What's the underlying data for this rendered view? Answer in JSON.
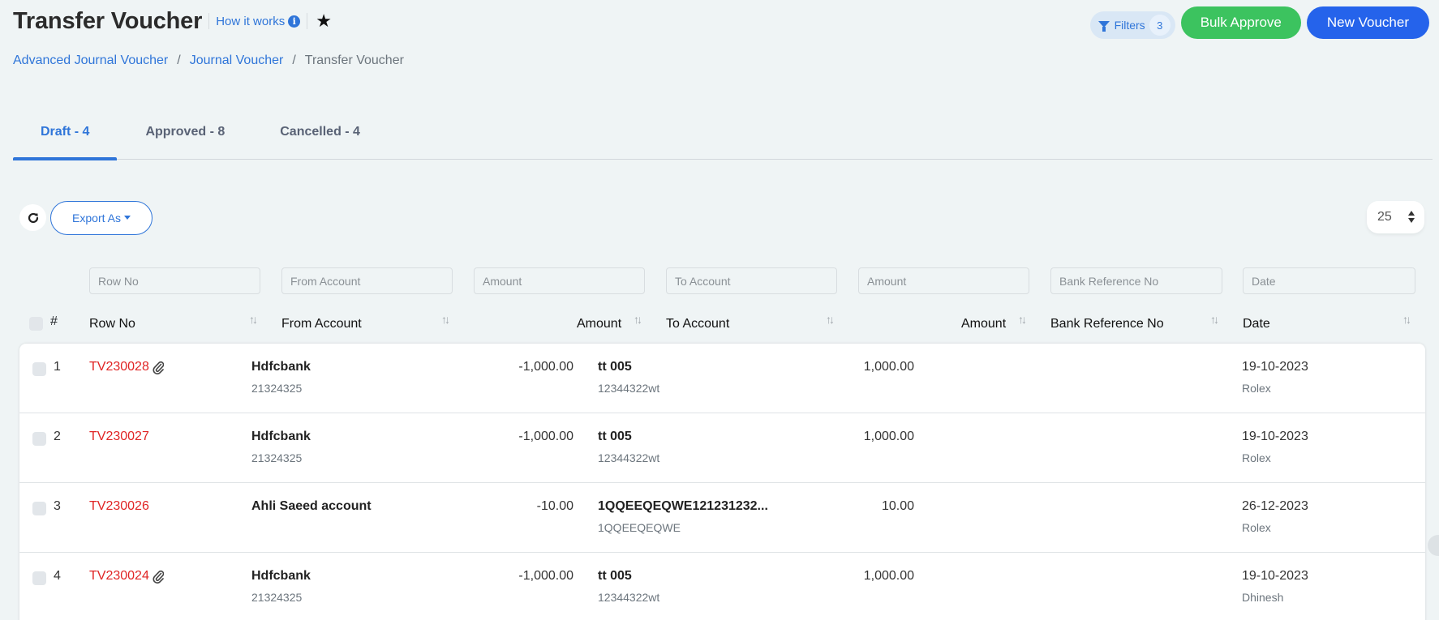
{
  "header": {
    "title": "Transfer Voucher",
    "how_it_works": "How it works",
    "info_icon": "info-circle-icon",
    "star_icon": "star-icon"
  },
  "breadcrumb": [
    {
      "label": "Advanced Journal Voucher",
      "link": true
    },
    {
      "label": "Journal Voucher",
      "link": true
    },
    {
      "label": "Transfer Voucher",
      "link": false
    }
  ],
  "breadcrumb_separator": "/",
  "actions": {
    "filters_label": "Filters",
    "filters_count": "3",
    "bulk_approve": "Bulk Approve",
    "new_voucher": "New Voucher",
    "colors": {
      "bulk_approve": "#3cc35f",
      "new_voucher": "#2563eb",
      "accent": "#2f75d9",
      "voucher_no": "#e02424"
    }
  },
  "tabs": [
    {
      "label": "Draft - 4",
      "active": true
    },
    {
      "label": "Approved - 8",
      "active": false
    },
    {
      "label": "Cancelled - 4",
      "active": false
    }
  ],
  "toolbar": {
    "export_label": "Export As",
    "page_size": "25"
  },
  "filters": {
    "row_no": "Row No",
    "from_account": "From Account",
    "from_amount": "Amount",
    "to_account": "To Account",
    "to_amount": "Amount",
    "bank_ref": "Bank Reference No",
    "date": "Date"
  },
  "columns": {
    "index": "#",
    "row_no": "Row No",
    "from_account": "From Account",
    "from_amount": "Amount",
    "to_account": "To Account",
    "to_amount": "Amount",
    "bank_ref": "Bank Reference No",
    "date": "Date"
  },
  "rows": [
    {
      "index": "1",
      "row_no": "TV230028",
      "attachment": true,
      "from_account": "Hdfcbank",
      "from_code": "21324325",
      "from_amount": "-1,000.00",
      "to_account": "tt 005",
      "to_code": "12344322wt",
      "to_amount": "1,000.00",
      "bank_ref": "",
      "date": "19-10-2023",
      "user": "Rolex"
    },
    {
      "index": "2",
      "row_no": "TV230027",
      "attachment": false,
      "from_account": "Hdfcbank",
      "from_code": "21324325",
      "from_amount": "-1,000.00",
      "to_account": "tt 005",
      "to_code": "12344322wt",
      "to_amount": "1,000.00",
      "bank_ref": "",
      "date": "19-10-2023",
      "user": "Rolex"
    },
    {
      "index": "3",
      "row_no": "TV230026",
      "attachment": false,
      "from_account": "Ahli Saeed account",
      "from_code": "",
      "from_amount": "-10.00",
      "to_account": "1QQEEQEQWE121231232...",
      "to_code": "1QQEEQEQWE",
      "to_amount": "10.00",
      "bank_ref": "",
      "date": "26-12-2023",
      "user": "Rolex"
    },
    {
      "index": "4",
      "row_no": "TV230024",
      "attachment": true,
      "from_account": "Hdfcbank",
      "from_code": "21324325",
      "from_amount": "-1,000.00",
      "to_account": "tt 005",
      "to_code": "12344322wt",
      "to_amount": "1,000.00",
      "bank_ref": "",
      "date": "19-10-2023",
      "user": "Dhinesh"
    }
  ]
}
